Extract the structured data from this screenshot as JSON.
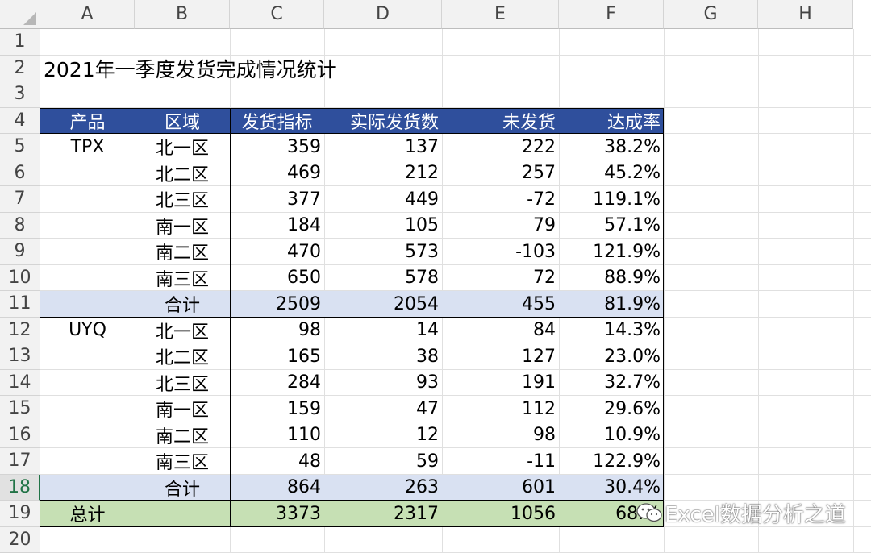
{
  "columns": [
    "A",
    "B",
    "C",
    "D",
    "E",
    "F",
    "G",
    "H"
  ],
  "rows": [
    "1",
    "2",
    "3",
    "4",
    "5",
    "6",
    "7",
    "8",
    "9",
    "10",
    "11",
    "12",
    "13",
    "14",
    "15",
    "16",
    "17",
    "18",
    "19",
    "20"
  ],
  "selected_row": "18",
  "title": "2021年一季度发货完成情况统计",
  "table": {
    "headers": [
      "产品",
      "区域",
      "发货指标",
      "实际发货数",
      "未发货",
      "达成率"
    ],
    "groups": [
      {
        "product": "TPX",
        "rows": [
          {
            "region": "北一区",
            "target": "359",
            "actual": "137",
            "pending": "222",
            "rate": "38.2%"
          },
          {
            "region": "北二区",
            "target": "469",
            "actual": "212",
            "pending": "257",
            "rate": "45.2%"
          },
          {
            "region": "北三区",
            "target": "377",
            "actual": "449",
            "pending": "-72",
            "rate": "119.1%"
          },
          {
            "region": "南一区",
            "target": "184",
            "actual": "105",
            "pending": "79",
            "rate": "57.1%"
          },
          {
            "region": "南二区",
            "target": "470",
            "actual": "573",
            "pending": "-103",
            "rate": "121.9%"
          },
          {
            "region": "南三区",
            "target": "650",
            "actual": "578",
            "pending": "72",
            "rate": "88.9%"
          }
        ],
        "subtotal": {
          "label": "合计",
          "target": "2509",
          "actual": "2054",
          "pending": "455",
          "rate": "81.9%"
        }
      },
      {
        "product": "UYQ",
        "rows": [
          {
            "region": "北一区",
            "target": "98",
            "actual": "14",
            "pending": "84",
            "rate": "14.3%"
          },
          {
            "region": "北二区",
            "target": "165",
            "actual": "38",
            "pending": "127",
            "rate": "23.0%"
          },
          {
            "region": "北三区",
            "target": "284",
            "actual": "93",
            "pending": "191",
            "rate": "32.7%"
          },
          {
            "region": "南一区",
            "target": "159",
            "actual": "47",
            "pending": "112",
            "rate": "29.6%"
          },
          {
            "region": "南二区",
            "target": "110",
            "actual": "12",
            "pending": "98",
            "rate": "10.9%"
          },
          {
            "region": "南三区",
            "target": "48",
            "actual": "59",
            "pending": "-11",
            "rate": "122.9%"
          }
        ],
        "subtotal": {
          "label": "合计",
          "target": "864",
          "actual": "263",
          "pending": "601",
          "rate": "30.4%"
        }
      }
    ],
    "grand_total": {
      "label": "总计",
      "target": "3373",
      "actual": "2317",
      "pending": "1056",
      "rate": "68.%"
    }
  },
  "watermark": "Excel数据分析之道",
  "colors": {
    "header_fill": "#2f4f9c",
    "subtotal_fill": "#d9e1f2",
    "total_fill": "#c6e0b4",
    "selection": "#217346"
  }
}
